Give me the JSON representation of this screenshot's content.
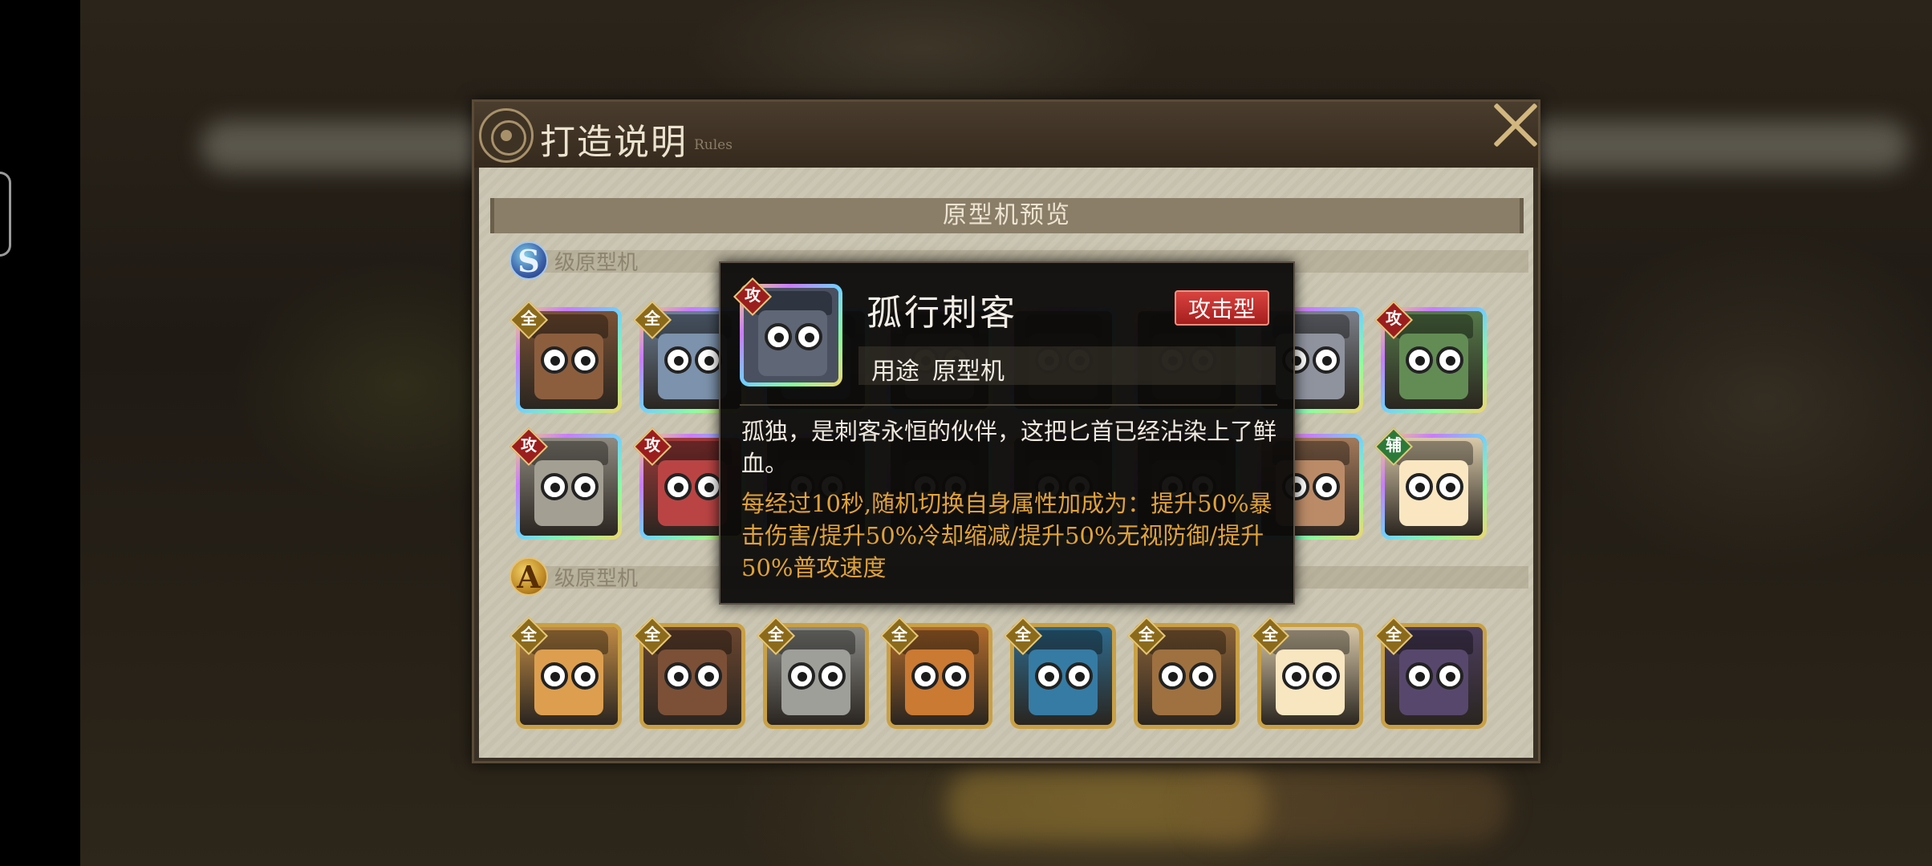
{
  "panel": {
    "title": "打造说明",
    "subtitle": "Rules",
    "section_title": "原型机预览"
  },
  "grades": [
    {
      "badge": "S",
      "label": "级原型机"
    },
    {
      "badge": "A",
      "label": "级原型机"
    }
  ],
  "s_cards": [
    {
      "tag": "全",
      "kind": "all",
      "theme": "#7a5236"
    },
    {
      "tag": "全",
      "kind": "all",
      "theme": "#6d7f96"
    },
    {
      "tag": "",
      "kind": "none",
      "theme": "#4d5566"
    },
    {
      "tag": "",
      "kind": "none",
      "theme": "#545454"
    },
    {
      "tag": "",
      "kind": "none",
      "theme": "#5a4d40"
    },
    {
      "tag": "",
      "kind": "none",
      "theme": "#574a3f"
    },
    {
      "tag": "",
      "kind": "none",
      "theme": "#7c8089"
    },
    {
      "tag": "攻",
      "kind": "atk",
      "theme": "#567a4a"
    },
    {
      "tag": "攻",
      "kind": "atk",
      "theme": "#8f8a80"
    },
    {
      "tag": "攻",
      "kind": "atk",
      "theme": "#a23b3b"
    },
    {
      "tag": "",
      "kind": "none",
      "theme": "#4d4a48"
    },
    {
      "tag": "",
      "kind": "none",
      "theme": "#4d4a48"
    },
    {
      "tag": "",
      "kind": "none",
      "theme": "#4d4a48"
    },
    {
      "tag": "",
      "kind": "none",
      "theme": "#4d4a48"
    },
    {
      "tag": "",
      "kind": "none",
      "theme": "#a3795a"
    },
    {
      "tag": "辅",
      "kind": "sup",
      "theme": "#d9c9a9"
    }
  ],
  "a_cards": [
    {
      "tag": "全",
      "kind": "all",
      "theme": "#c08a45"
    },
    {
      "tag": "全",
      "kind": "all",
      "theme": "#6b4630"
    },
    {
      "tag": "全",
      "kind": "all",
      "theme": "#8a8a86"
    },
    {
      "tag": "全",
      "kind": "all",
      "theme": "#b06a2c"
    },
    {
      "tag": "全",
      "kind": "all",
      "theme": "#2f6b8e"
    },
    {
      "tag": "全",
      "kind": "all",
      "theme": "#8a6238"
    },
    {
      "tag": "全",
      "kind": "all",
      "theme": "#d8c8a8"
    },
    {
      "tag": "全",
      "kind": "all",
      "theme": "#4c3e5e"
    }
  ],
  "tooltip": {
    "tag": "攻",
    "name": "孤行刺客",
    "type": "攻击型",
    "usage_label": "用途",
    "usage_value": "原型机",
    "description": "孤独，是刺客永恒的伙伴，这把匕首已经沾染上了鲜血。",
    "effect": "每经过10秒,随机切换自身属性加成为：提升50%暴击伤害/提升50%冷却缩减/提升50%无视防御/提升50%普攻速度"
  },
  "colors": {
    "accent_gold": "#d2b77f",
    "effect_orange": "#e0a23a",
    "type_red": "#c53030"
  }
}
